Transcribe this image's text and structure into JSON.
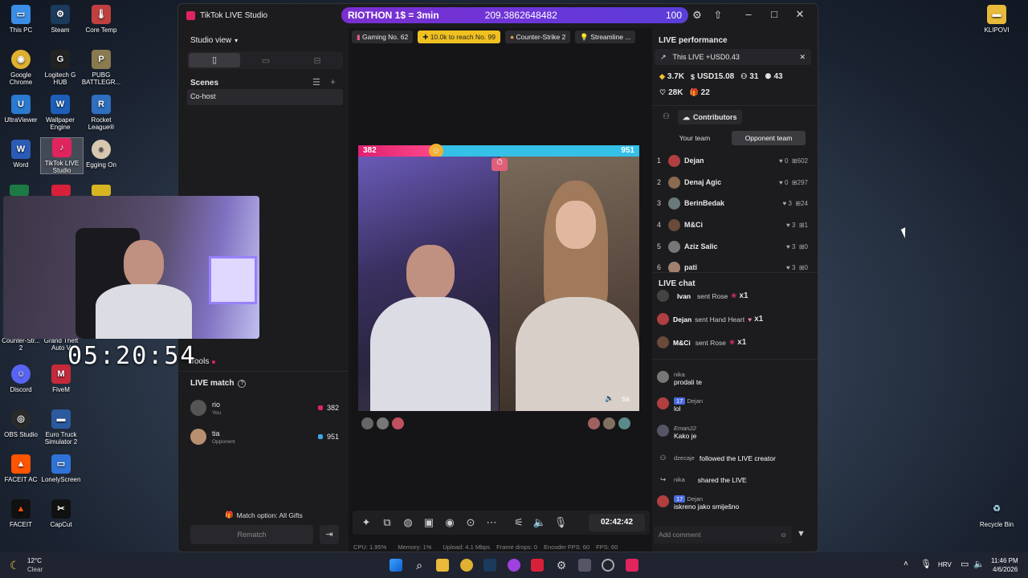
{
  "desktop_icons": [
    {
      "label": "This PC"
    },
    {
      "label": "Steam"
    },
    {
      "label": "Core Temp"
    },
    {
      "label": "Google Chrome"
    },
    {
      "label": "Logitech G HUB"
    },
    {
      "label": "PUBG BATTLEGR..."
    },
    {
      "label": "UltraViewer"
    },
    {
      "label": "Wallpaper Engine"
    },
    {
      "label": "Rocket League®"
    },
    {
      "label": "Word"
    },
    {
      "label": "TikTok LIVE Studio"
    },
    {
      "label": "Egging On"
    },
    {
      "label": "Counter-Str... 2"
    },
    {
      "label": "Grand Theft Auto V"
    },
    {
      "label": "Discord"
    },
    {
      "label": "FiveM"
    },
    {
      "label": "OBS Studio"
    },
    {
      "label": "Euro Truck Simulator 2"
    },
    {
      "label": "FACEIT AC"
    },
    {
      "label": "LonelyScreen"
    },
    {
      "label": "FACEIT"
    },
    {
      "label": "CapCut"
    },
    {
      "label": "KLIPOVI"
    },
    {
      "label": "Recycle Bin"
    }
  ],
  "overlay": {
    "timer": "05:20:54"
  },
  "window": {
    "title": "TikTok LIVE Studio",
    "banner": {
      "text": "RIOTHON 1$ = 3min",
      "value": "209.3862648482",
      "max": "100"
    }
  },
  "left": {
    "studio_view": "Studio view",
    "scenes_title": "Scenes",
    "scene_item": "Co-host",
    "tools_label": "Tools",
    "live_match_title": "LIVE match",
    "players": [
      {
        "name": "rio",
        "role": "You",
        "score": "382"
      },
      {
        "name": "tia",
        "role": "Opponent",
        "score": "951"
      }
    ],
    "match_option": "Match option: All Gifts",
    "rematch": "Rematch"
  },
  "center": {
    "topics": [
      "Gaming No. 62",
      "10.0k to reach No. 99",
      "Counter-Strike 2",
      "Streamline ..."
    ],
    "battle": {
      "left_score": "382",
      "right_score": "951",
      "left_fraction": 0.287
    },
    "opponent_name": "tia",
    "timer": "02:42:42",
    "stats": {
      "cpu": "CPU: 1.95%",
      "memory": "Memory: 1%",
      "upload": "Upload: 4.1 Mbps",
      "frame_drops": "Frame drops: 0",
      "encoder_fps": "Encoder FPS: 60",
      "fps": "FPS: 60"
    }
  },
  "right": {
    "perf_title": "LIVE performance",
    "this_live": "This LIVE +USD0.43",
    "stats": {
      "diamonds": "3.7K",
      "usd": "USD15.08",
      "viewers": "31",
      "people": "43",
      "likes": "28K",
      "gifts": "22"
    },
    "contributors_title": "Contributors",
    "tab_your": "Your team",
    "tab_opponent": "Opponent team",
    "contributors": [
      {
        "rank": "1",
        "name": "Dejan",
        "likes": "0",
        "gifts": "602"
      },
      {
        "rank": "2",
        "name": "Denaj Agic",
        "likes": "0",
        "gifts": "297"
      },
      {
        "rank": "3",
        "name": "BerinBedak",
        "likes": "3",
        "gifts": "24"
      },
      {
        "rank": "4",
        "name": "M&Ci",
        "likes": "3",
        "gifts": "1"
      },
      {
        "rank": "5",
        "name": "Aziz Salic",
        "likes": "3",
        "gifts": "0"
      },
      {
        "rank": "6",
        "name": "pati",
        "likes": "3",
        "gifts": "0"
      }
    ],
    "chat_title": "LIVE chat",
    "gift_msgs": [
      {
        "name": "Ivan",
        "text": "sent Rose",
        "count": "x1"
      },
      {
        "name": "Dejan",
        "text": "sent Hand Heart",
        "count": "x1"
      },
      {
        "name": "M&Ci",
        "text": "sent Rose",
        "count": "x1"
      }
    ],
    "chat_msgs": [
      {
        "name": "nika",
        "level": "",
        "text": "prodali te"
      },
      {
        "name": "Dejan",
        "level": "17",
        "text": "lol"
      },
      {
        "name": "Eman22",
        "level": "",
        "text": "Kako je"
      },
      {
        "name": "dzecaje",
        "level": "",
        "text": "followed the LIVE creator"
      },
      {
        "name": "nika",
        "level": "",
        "text": "shared the LIVE"
      },
      {
        "name": "Dejan",
        "level": "17",
        "text": "iskreno jako smiješno"
      }
    ],
    "add_comment": "Add comment"
  },
  "taskbar": {
    "weather_temp": "12°C",
    "weather_desc": "Clear",
    "lang": "HRV",
    "time": "11:46 PM",
    "date": "4/6/2026"
  }
}
